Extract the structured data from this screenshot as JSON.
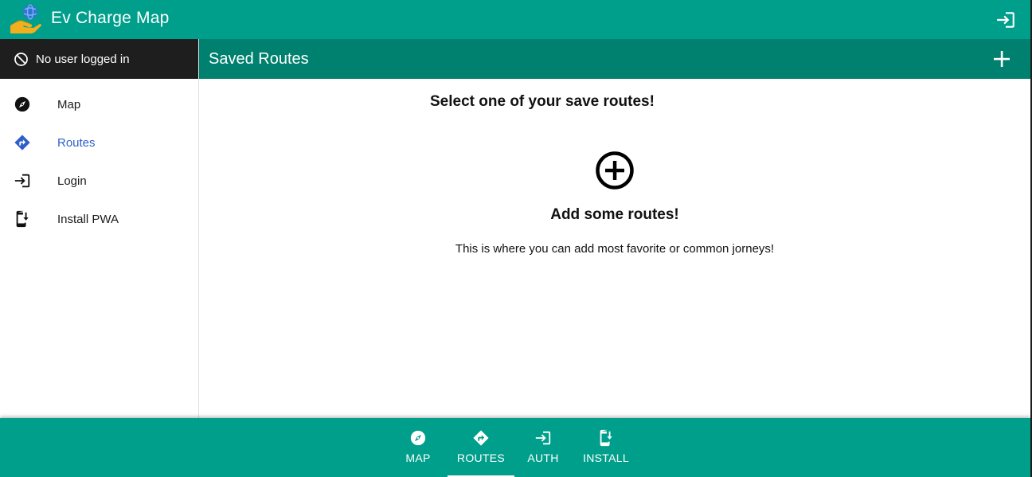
{
  "app": {
    "title": "Ev Charge Map",
    "accent_color": "#009f8b",
    "header_dark_color": "#00806e",
    "logo_icon": "globe-hand-logo",
    "top_action_icon": "login-icon"
  },
  "sidebar": {
    "user_status": "No user logged in",
    "user_status_icon": "block-icon",
    "items": [
      {
        "label": "Map",
        "icon": "compass-icon",
        "active": false
      },
      {
        "label": "Routes",
        "icon": "directions-icon",
        "active": true
      },
      {
        "label": "Login",
        "icon": "login-icon",
        "active": false
      },
      {
        "label": "Install PWA",
        "icon": "install-mobile-icon",
        "active": false
      }
    ]
  },
  "main": {
    "title": "Saved Routes",
    "add_icon": "plus-icon",
    "heading": "Select one of your save routes!",
    "empty_icon": "add-circle-icon",
    "empty_title": "Add some routes!",
    "empty_description": "This is where you can add most favorite or common jorneys!"
  },
  "bottom_nav": {
    "items": [
      {
        "label": "MAP",
        "icon": "compass-icon",
        "active": false
      },
      {
        "label": "ROUTES",
        "icon": "directions-icon",
        "active": true
      },
      {
        "label": "AUTH",
        "icon": "login-icon",
        "active": false
      },
      {
        "label": "INSTALL",
        "icon": "install-mobile-icon",
        "active": false
      }
    ]
  }
}
